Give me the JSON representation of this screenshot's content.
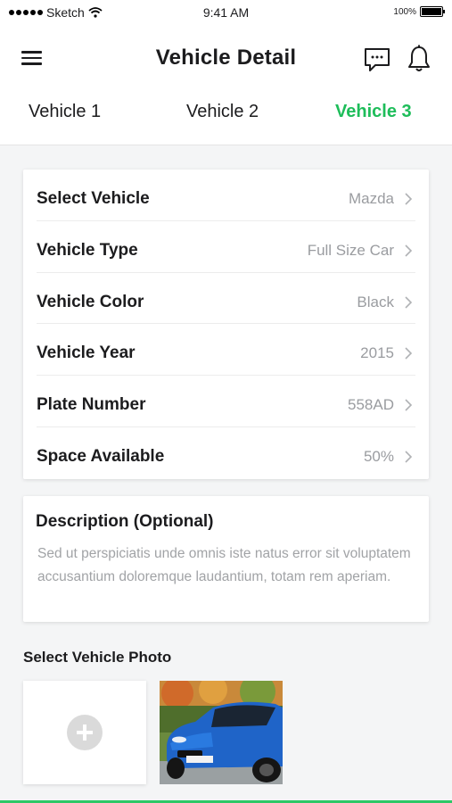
{
  "status_bar": {
    "carrier": "Sketch",
    "time": "9:41 AM",
    "battery": "100%",
    "battery_level": 1.0
  },
  "header": {
    "title": "Vehicle Detail"
  },
  "tabs": [
    {
      "label": "Vehicle 1",
      "active": false
    },
    {
      "label": "Vehicle 2",
      "active": false
    },
    {
      "label": "Vehicle 3",
      "active": true
    }
  ],
  "details": [
    {
      "label": "Select Vehicle",
      "value": "Mazda"
    },
    {
      "label": "Vehicle Type",
      "value": "Full Size Car"
    },
    {
      "label": "Vehicle Color",
      "value": "Black"
    },
    {
      "label": "Vehicle Year",
      "value": "2015"
    },
    {
      "label": "Plate Number",
      "value": "558AD"
    },
    {
      "label": "Space Available",
      "value": "50%"
    }
  ],
  "description": {
    "title": "Description (Optional)",
    "text": "Sed ut perspiciatis unde omnis iste natus error sit voluptatem accusantium doloremque laudantium, totam rem aperiam."
  },
  "photos": {
    "label": "Select Vehicle Photo"
  },
  "colors": {
    "accent": "#1ebd5a",
    "muted_text": "#9a9ca0",
    "background": "#f4f5f6"
  },
  "icons": {
    "menu": "hamburger-menu-icon",
    "chat": "chat-bubble-icon",
    "notifications": "bell-icon",
    "add": "plus-circle-icon",
    "row": "chevron-right-icon"
  }
}
